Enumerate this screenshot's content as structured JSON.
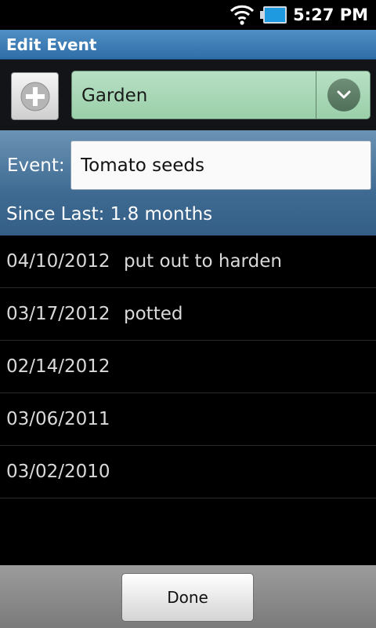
{
  "status_bar": {
    "time": "5:27 PM",
    "wifi_icon": "wifi-icon",
    "battery_icon": "battery-icon"
  },
  "title_bar": {
    "title": "Edit Event"
  },
  "category": {
    "add_icon": "plus-icon",
    "selected": "Garden",
    "dropdown_icon": "chevron-down-icon"
  },
  "event": {
    "label": "Event:",
    "value": "Tomato seeds",
    "since_last": "Since Last: 1.8 months"
  },
  "history": [
    {
      "date": "04/10/2012",
      "note": "put out to harden"
    },
    {
      "date": "03/17/2012",
      "note": "potted"
    },
    {
      "date": "02/14/2012",
      "note": ""
    },
    {
      "date": "03/06/2011",
      "note": ""
    },
    {
      "date": "03/02/2010",
      "note": ""
    }
  ],
  "footer": {
    "done_label": "Done"
  },
  "colors": {
    "title_bar": "#3a7bb3",
    "spinner": "#a8d7b5",
    "event_panel": "#4a7aa2",
    "list_background": "#000000",
    "bottom_bar": "#8c8c8c"
  }
}
